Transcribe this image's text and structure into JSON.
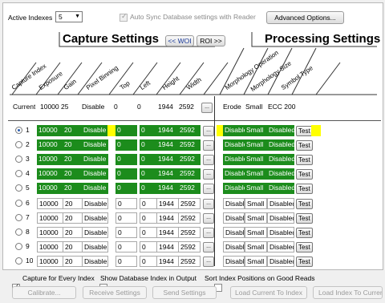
{
  "top": {
    "active_indexes_label": "Active Indexes",
    "active_indexes_value": "5",
    "auto_sync_label": "Auto Sync Database settings with Reader",
    "advanced_button": "Advanced Options..."
  },
  "headers": {
    "capture": "Capture Settings",
    "processing": "Processing Settings",
    "woi_button": "<< WOI",
    "roi_button": "ROI >>",
    "capture_columns": [
      "Capture Index",
      "Exposure",
      "Gain",
      "Pixel Binning",
      "Top",
      "Left",
      "Height",
      "Width"
    ],
    "processing_columns": [
      "Morphology Operation",
      "Morphology Size",
      "Symbol Type"
    ]
  },
  "current": {
    "label": "Current",
    "exposure": "10000",
    "gain": "25",
    "binning": "Disable",
    "top": "0",
    "left": "0",
    "height": "1944",
    "width": "2592",
    "morph_op": "Erode",
    "morph_size": "Small",
    "symbol_type": "ECC 200"
  },
  "rows": [
    {
      "index": "1",
      "exposure": "10000",
      "gain": "20",
      "binning": "Disable",
      "top": "0",
      "left": "0",
      "height": "1944",
      "width": "2592",
      "morph_op": "Disable",
      "morph_size": "Small",
      "symbol": "Disabled",
      "test": "Test",
      "selected": true,
      "active": true
    },
    {
      "index": "2",
      "exposure": "10000",
      "gain": "20",
      "binning": "Disable",
      "top": "0",
      "left": "0",
      "height": "1944",
      "width": "2592",
      "morph_op": "Disable",
      "morph_size": "Small",
      "symbol": "Disabled",
      "test": "Test",
      "selected": false,
      "active": true
    },
    {
      "index": "3",
      "exposure": "10000",
      "gain": "20",
      "binning": "Disable",
      "top": "0",
      "left": "0",
      "height": "1944",
      "width": "2592",
      "morph_op": "Disable",
      "morph_size": "Small",
      "symbol": "Disabled",
      "test": "Test",
      "selected": false,
      "active": true
    },
    {
      "index": "4",
      "exposure": "10000",
      "gain": "20",
      "binning": "Disable",
      "top": "0",
      "left": "0",
      "height": "1944",
      "width": "2592",
      "morph_op": "Disable",
      "morph_size": "Small",
      "symbol": "Disabled",
      "test": "Test",
      "selected": false,
      "active": true
    },
    {
      "index": "5",
      "exposure": "10000",
      "gain": "20",
      "binning": "Disable",
      "top": "0",
      "left": "0",
      "height": "1944",
      "width": "2592",
      "morph_op": "Disable",
      "morph_size": "Small",
      "symbol": "Disabled",
      "test": "Test",
      "selected": false,
      "active": true
    },
    {
      "index": "6",
      "exposure": "10000",
      "gain": "20",
      "binning": "Disable",
      "top": "0",
      "left": "0",
      "height": "1944",
      "width": "2592",
      "morph_op": "Disable",
      "morph_size": "Small",
      "symbol": "Disabled",
      "test": "Test",
      "selected": false,
      "active": false
    },
    {
      "index": "7",
      "exposure": "10000",
      "gain": "20",
      "binning": "Disable",
      "top": "0",
      "left": "0",
      "height": "1944",
      "width": "2592",
      "morph_op": "Disable",
      "morph_size": "Small",
      "symbol": "Disabled",
      "test": "Test",
      "selected": false,
      "active": false
    },
    {
      "index": "8",
      "exposure": "10000",
      "gain": "20",
      "binning": "Disable",
      "top": "0",
      "left": "0",
      "height": "1944",
      "width": "2592",
      "morph_op": "Disable",
      "morph_size": "Small",
      "symbol": "Disabled",
      "test": "Test",
      "selected": false,
      "active": false
    },
    {
      "index": "9",
      "exposure": "10000",
      "gain": "20",
      "binning": "Disable",
      "top": "0",
      "left": "0",
      "height": "1944",
      "width": "2592",
      "morph_op": "Disable",
      "morph_size": "Small",
      "symbol": "Disabled",
      "test": "Test",
      "selected": false,
      "active": false
    },
    {
      "index": "10",
      "exposure": "10000",
      "gain": "20",
      "binning": "Disable",
      "top": "0",
      "left": "0",
      "height": "1944",
      "width": "2592",
      "morph_op": "Disable",
      "morph_size": "Small",
      "symbol": "Disabled",
      "test": "Test",
      "selected": false,
      "active": false
    }
  ],
  "options": {
    "capture_every_index": "Capture for Every Index",
    "show_db_index": "Show Database Index in Output",
    "sort_positions": "Sort Index Positions on Good Reads"
  },
  "buttons": {
    "calibrate": "Calibrate...",
    "receive": "Receive Settings",
    "send": "Send Settings",
    "load_current_to_index": "Load Current To Index",
    "load_index_to_current": "Load Index To Current"
  },
  "colors": {
    "active_green": "#1c8c1c",
    "highlight_yellow": "#ffff00"
  }
}
